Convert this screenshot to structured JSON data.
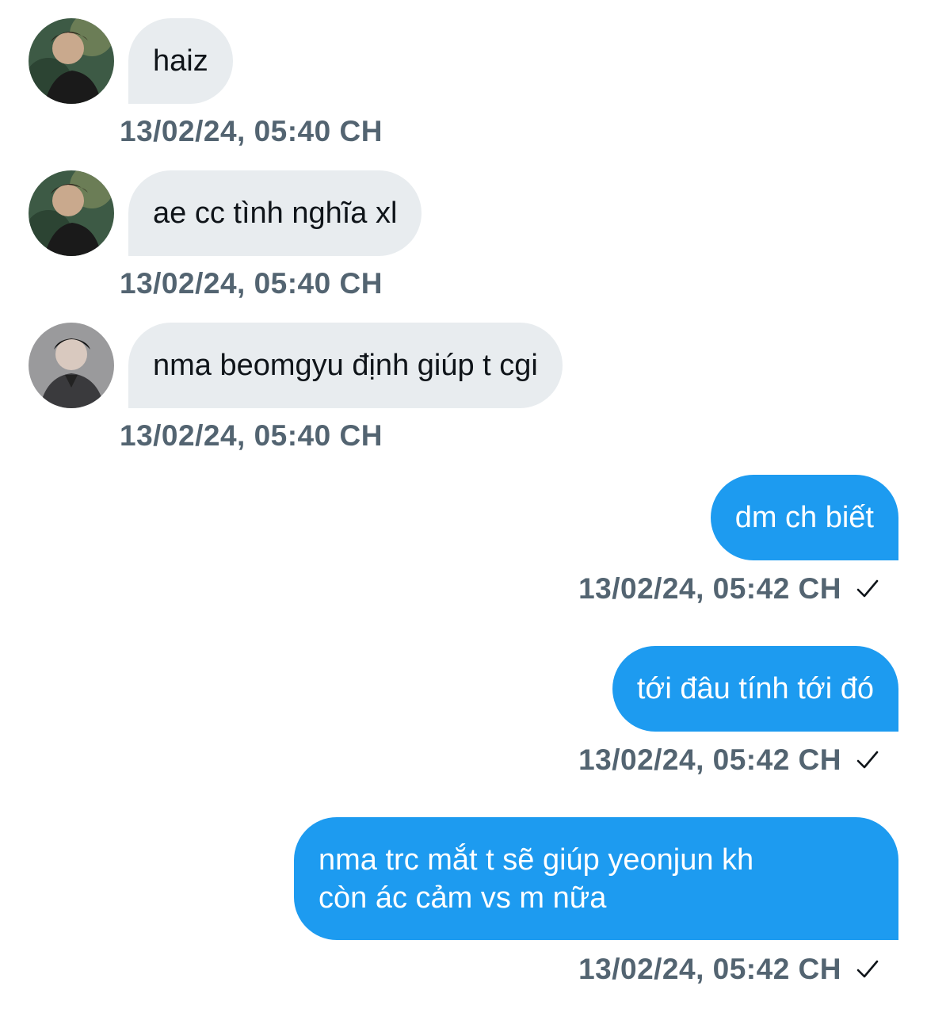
{
  "messages": [
    {
      "direction": "in",
      "avatar": "avatar-user-a",
      "text": "haiz",
      "timestamp": "13/02/24, 05:40 CH"
    },
    {
      "direction": "in",
      "avatar": "avatar-user-a",
      "text": "ae cc tình nghĩa xl",
      "timestamp": "13/02/24, 05:40 CH"
    },
    {
      "direction": "in",
      "avatar": "avatar-user-b",
      "text": "nma beomgyu định giúp t cgi",
      "timestamp": "13/02/24, 05:40 CH"
    },
    {
      "direction": "out",
      "text": "dm ch biết",
      "timestamp": "13/02/24, 05:42 CH",
      "status_icon": "check-icon"
    },
    {
      "direction": "out",
      "text": "tới đâu tính tới đó",
      "timestamp": "13/02/24, 05:42 CH",
      "status_icon": "check-icon"
    },
    {
      "direction": "out",
      "text_lines": [
        "nma trc mắt t sẽ giúp yeonjun kh",
        "còn ác cảm vs m nữa"
      ],
      "timestamp": "13/02/24, 05:42 CH",
      "status_icon": "check-icon"
    }
  ],
  "colors": {
    "incoming_bubble": "#e8ecef",
    "outgoing_bubble": "#1d9bf0",
    "timestamp_text": "#536471",
    "incoming_text": "#0f1419",
    "outgoing_text": "#ffffff"
  }
}
